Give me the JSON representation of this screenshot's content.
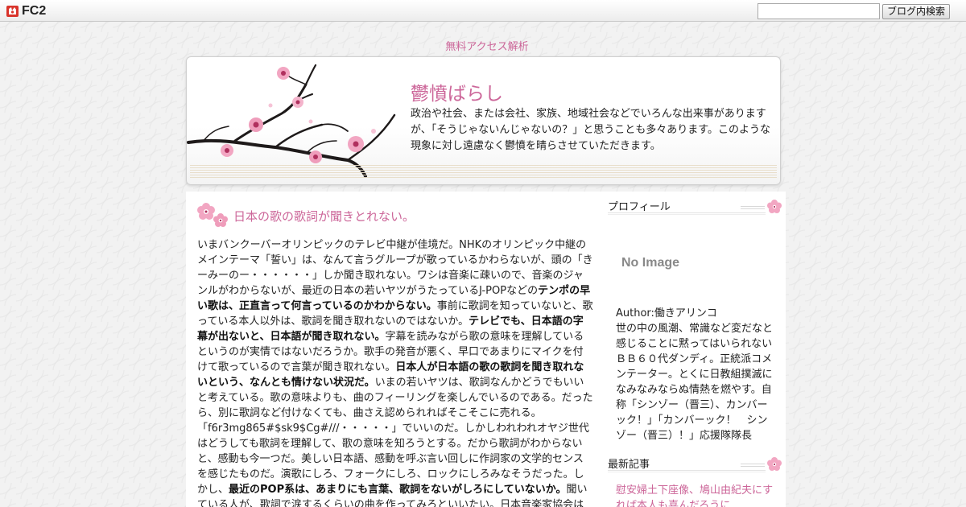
{
  "topbar": {
    "logo_text": "FC2",
    "search_placeholder": "",
    "search_button": "ブログ内検索"
  },
  "access_link": "無料アクセス解析",
  "header": {
    "title": "鬱憤ばらし",
    "description": "政治や社会、または会社、家族、地域社会などでいろんな出来事がありますが、「そうじゃないんじゃないの？」と思うことも多々あります。このような現象に対し遠慮なく鬱憤を晴らさせていただきます。"
  },
  "entry": {
    "title": "日本の歌の歌詞が聞きとれない。",
    "paragraphs": [
      {
        "text": "いまバンクーバーオリンピックのテレビ中継が佳境だ。NHKのオリンピック中継のメインテーマ「誓い」は、なんて言うグループが歌っているかわらないが、頭の「きーみーのー・・・・・・」しか聞き取れない。ワシは音楽に疎いので、音楽のジャンルがわからないが、最近の日本の若いヤツがうたっているJ-POPなどの",
        "bold": false
      },
      {
        "text": "テンポの早い歌は、正直言って何言っているのかわからない。",
        "bold": true
      },
      {
        "text": "事前に歌詞を知っていないと、歌っている本人以外は、歌詞を聞き取れないのではないか。",
        "bold": false
      },
      {
        "text": "テレビでも、日本語の字幕が出ないと、日本語が聞き取れない。",
        "bold": true
      },
      {
        "text": "字幕を読みながら歌の意味を理解しているというのが実情ではないだろうか。歌手の発音が悪く、早口であまりにマイクを付けて歌っているので言葉が聞き取れない。",
        "bold": false
      },
      {
        "text": "日本人が日本語の歌の歌詞を聞き取れないという、なんとも情けない状況だ。",
        "bold": true
      },
      {
        "text": "いまの若いヤツは、歌詞なんかどうでもいいと考えている。歌の意味よりも、曲のフィーリングを楽しんでいるのである。だったら、別に歌詞など付けなくても、曲さえ認められればそこそこに売れる。「f6r3mg865#$sk9$Cg#///・・・・・」でいいのだ。しかしわれわれオヤジ世代はどうしても歌詞を理解して、歌の意味を知ろうとする。だから歌詞がわからないと、感動も今一つだ。美しい日本語、感動を呼ぶ言い回しに作詞家の文学的センスを感じたものだ。演歌にしろ、フォークにしろ、ロックにしろみなそうだった。しかし、",
        "bold": false
      },
      {
        "text": "最近のPOP系は、あまりにも言葉、歌詞をないがしろにしていないか。",
        "bold": true
      },
      {
        "text": "聞いている人が、歌詞で涙するくらいの曲を作ってみろといいたい。日本音楽家協会は",
        "bold": false
      }
    ]
  },
  "sidebar": {
    "profile_heading": "プロフィール",
    "noimage": "No Image",
    "author": "Author:働きアリンコ",
    "bio": "世の中の風潮、常識など変だなと感じることに黙ってはいられないＢＢ６０代ダンディ。正統派コメンテーター。とくに日教組撲滅になみなみならぬ情熱を燃やす。自称「シンゾー（晋三）、カンバーック！」「カンバーック！　シンゾー（晋三）！」応援隊隊長",
    "recent_heading": "最新記事",
    "recent_item": "慰安婦土下座像、鳩山由紀夫にすれば本人も喜んだろうに"
  },
  "colors": {
    "accent": "#cc6699",
    "text": "#222222"
  }
}
